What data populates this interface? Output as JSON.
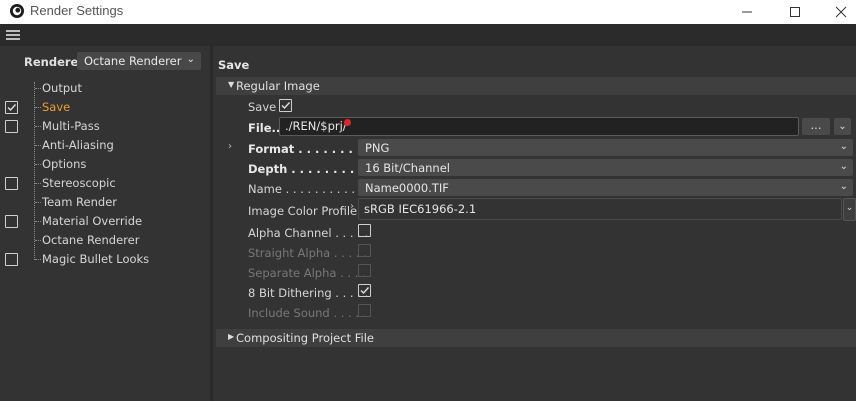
{
  "window": {
    "title": "Render Settings",
    "icon": "cinema4d-icon",
    "controls": {
      "minimize": "—",
      "maximize": "☐",
      "close": "✕"
    }
  },
  "menubar": {
    "icon": "hamburger-menu-icon"
  },
  "renderer": {
    "label": "Renderer",
    "selected": "Octane Renderer"
  },
  "tree": [
    {
      "label": "Output",
      "checkbox": false,
      "checked": false,
      "active": false
    },
    {
      "label": "Save",
      "checkbox": true,
      "checked": true,
      "active": true
    },
    {
      "label": "Multi-Pass",
      "checkbox": true,
      "checked": false,
      "active": false
    },
    {
      "label": "Anti-Aliasing",
      "checkbox": false,
      "checked": false,
      "active": false
    },
    {
      "label": "Options",
      "checkbox": false,
      "checked": false,
      "active": false
    },
    {
      "label": "Stereoscopic",
      "checkbox": true,
      "checked": false,
      "active": false
    },
    {
      "label": "Team Render",
      "checkbox": false,
      "checked": false,
      "active": false
    },
    {
      "label": "Material Override",
      "checkbox": true,
      "checked": false,
      "active": false
    },
    {
      "label": "Octane Renderer",
      "checkbox": false,
      "checked": false,
      "active": false
    },
    {
      "label": "Magic Bullet Looks",
      "checkbox": true,
      "checked": false,
      "active": false
    }
  ],
  "main": {
    "header": "Save",
    "regular_image": {
      "title": "Regular Image",
      "save_label": "Save",
      "save_checked": true,
      "file_label": "File...",
      "file_value": "./REN/$prj/",
      "browse_label": "...",
      "format_label": "Format",
      "format_value": "PNG",
      "depth_label": "Depth",
      "depth_value": "16 Bit/Channel",
      "name_label": "Name",
      "name_value": "Name0000.TIF",
      "profile_label": "Image Color Profile",
      "profile_value": "sRGB IEC61966-2.1",
      "alpha_channel_label": "Alpha Channel",
      "straight_alpha_label": "Straight Alpha",
      "separate_alpha_label": "Separate Alpha",
      "dithering_label": "8 Bit Dithering",
      "include_sound_label": "Include Sound",
      "alpha_checked": false,
      "dithering_checked": true
    },
    "compositing": {
      "title": "Compositing Project File"
    }
  },
  "colors": {
    "accent": "#ef9c30",
    "panel": "#333333",
    "field": "#4a4a4a",
    "marker": "#e02525"
  }
}
